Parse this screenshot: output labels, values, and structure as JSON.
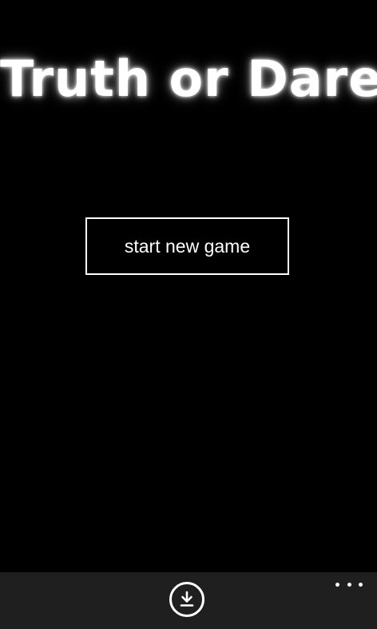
{
  "app": {
    "title": "Truth or Dare"
  },
  "main": {
    "start_button_label": "start new game"
  },
  "app_bar": {
    "primary_icon": "download-icon",
    "more_icon": "ellipsis-icon"
  },
  "colors": {
    "background": "#000000",
    "foreground": "#ffffff",
    "app_bar": "#1f1f1f"
  }
}
